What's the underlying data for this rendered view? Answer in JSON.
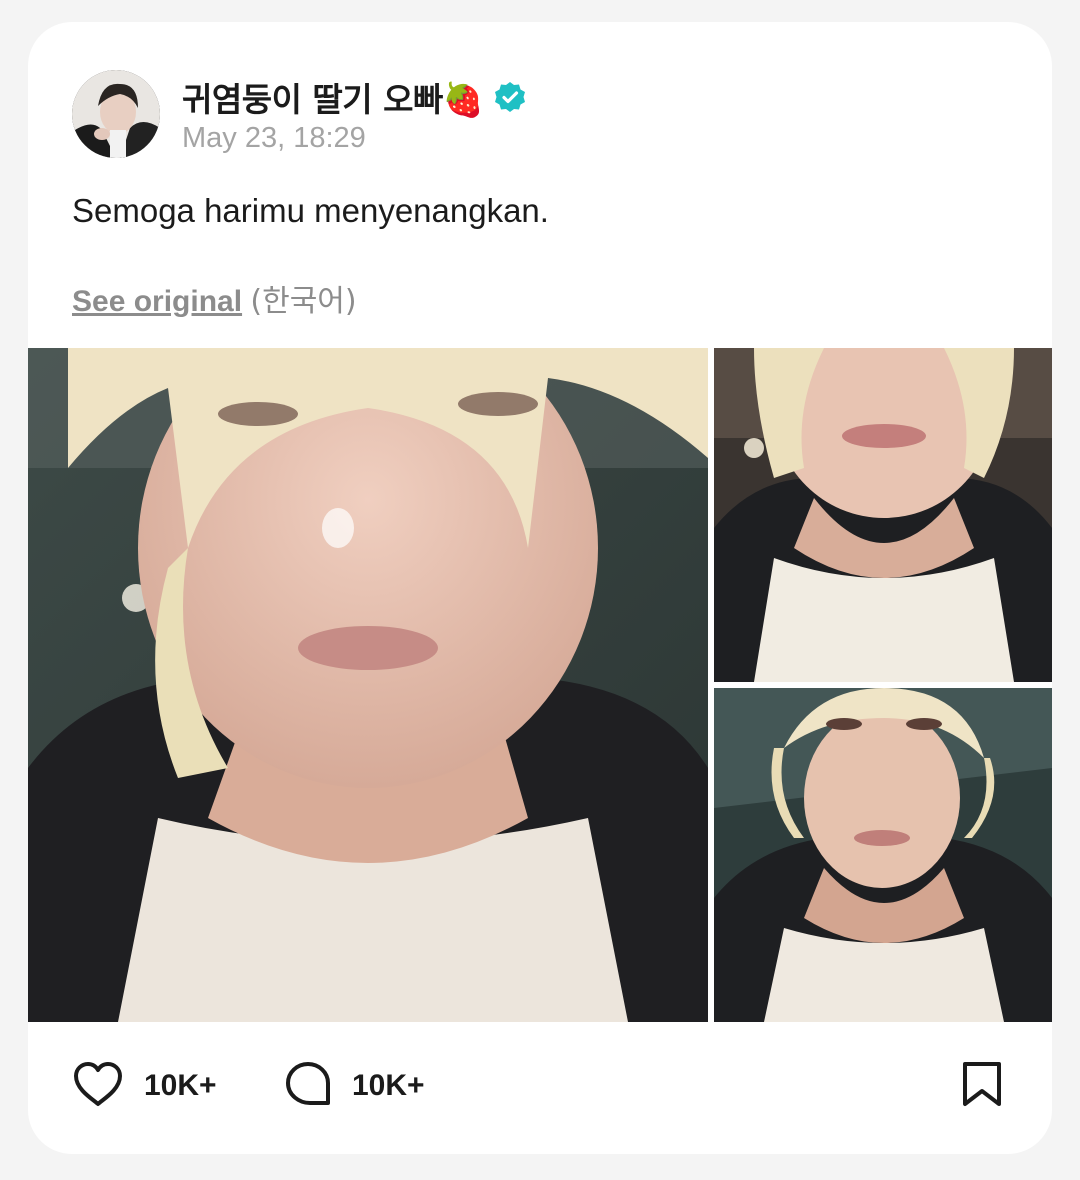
{
  "post": {
    "author": {
      "name": "귀염둥이 딸기 오빠🍓",
      "avatar_icon": "avatar-photo",
      "verified_icon": "verified-badge-icon",
      "verified_color": "#1fc0c4"
    },
    "timestamp": "May 23, 18:29",
    "text": "Semoga harimu menyenangkan.",
    "translation": {
      "see_original_label": "See original",
      "language_label": "(한국어)"
    },
    "media": [
      {
        "alt": "selfie photo 1"
      },
      {
        "alt": "selfie photo 2"
      },
      {
        "alt": "selfie photo 3"
      }
    ],
    "actions": {
      "like_icon": "heart-icon",
      "like_count": "10K+",
      "comment_icon": "comment-bubble-icon",
      "comment_count": "10K+",
      "bookmark_icon": "bookmark-icon"
    }
  },
  "colors": {
    "background": "#f4f4f4",
    "card": "#ffffff",
    "text_primary": "#1b1b1b",
    "text_secondary": "#a4a4a4"
  }
}
